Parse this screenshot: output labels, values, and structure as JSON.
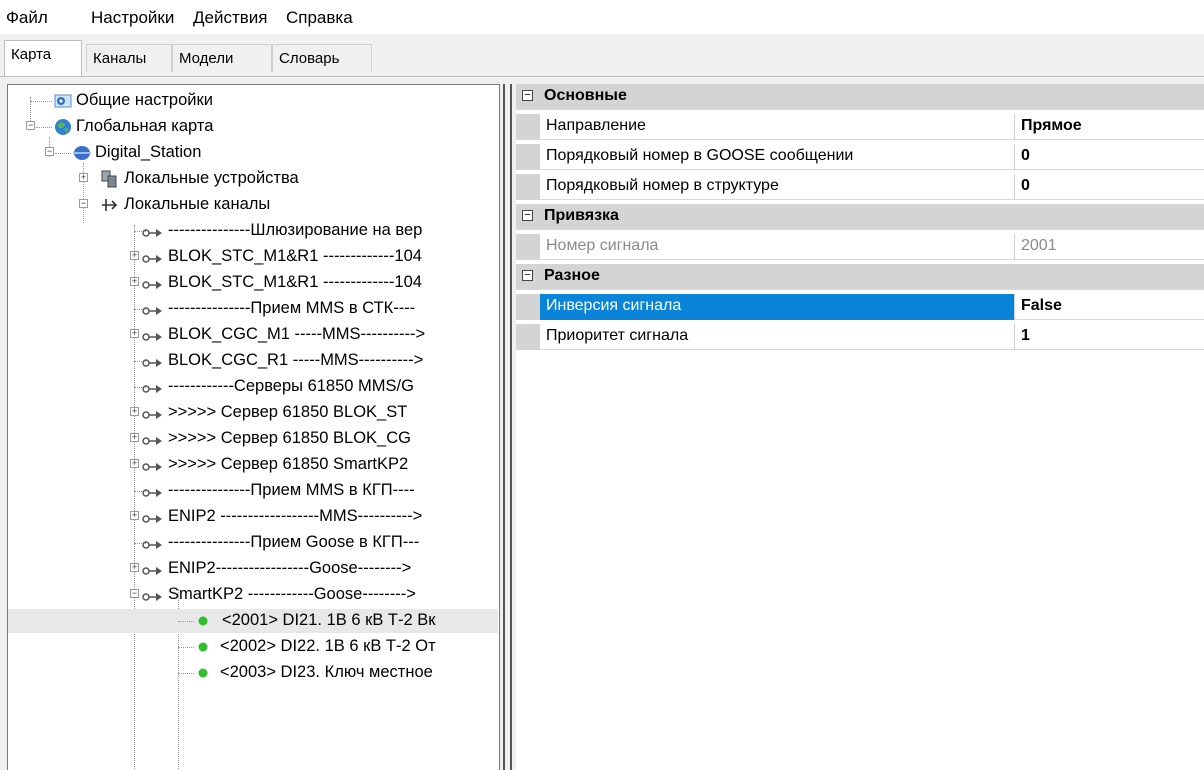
{
  "menu": [
    "Файл",
    "Настройки",
    "Действия",
    "Справка"
  ],
  "tabs": [
    "Карта",
    "Каналы",
    "Модели",
    "Словарь"
  ],
  "tree": [
    {
      "label": "Общие настройки",
      "icon": "settings-icon"
    },
    {
      "label": "Глобальная карта",
      "icon": "globe-icon"
    },
    {
      "label": "Digital_Station",
      "icon": "station-icon"
    },
    {
      "label": "Локальные устройства",
      "icon": "devices-icon"
    },
    {
      "label": "Локальные каналы",
      "icon": "channels-icon"
    },
    {
      "label": "---------------Шлюзирование на вер",
      "icon": "channel-icon"
    },
    {
      "label": "BLOK_STC_M1&R1 -------------104",
      "icon": "channel-icon"
    },
    {
      "label": "BLOK_STC_M1&R1 -------------104",
      "icon": "channel-icon"
    },
    {
      "label": "---------------Прием MMS в СТК----",
      "icon": "channel-icon"
    },
    {
      "label": "BLOK_CGC_M1 -----MMS---------->",
      "icon": "channel-icon"
    },
    {
      "label": "BLOK_CGC_R1 -----MMS---------->",
      "icon": "channel-icon"
    },
    {
      "label": "------------Серверы 61850 MMS/G",
      "icon": "channel-icon"
    },
    {
      "label": ">>>>>  Сервер 61850 BLOK_ST",
      "icon": "channel-icon"
    },
    {
      "label": ">>>>>  Сервер 61850 BLOK_CG",
      "icon": "channel-icon"
    },
    {
      "label": ">>>>>  Сервер 61850 SmartKP2",
      "icon": "channel-icon"
    },
    {
      "label": "---------------Прием MMS в КГП----",
      "icon": "channel-icon"
    },
    {
      "label": "ENIP2 ------------------MMS---------->",
      "icon": "channel-icon"
    },
    {
      "label": "---------------Прием Goose в КГП---",
      "icon": "channel-icon"
    },
    {
      "label": "ENIP2-----------------Goose-------->",
      "icon": "channel-icon"
    },
    {
      "label": "SmartKP2 ------------Goose-------->",
      "icon": "channel-icon"
    },
    {
      "label": "<2001> DI21. 1В 6 кВ Т-2 Вк",
      "icon": "signal-dot-icon"
    },
    {
      "label": "<2002> DI22. 1В 6 кВ Т-2 От",
      "icon": "signal-dot-icon"
    },
    {
      "label": "<2003> DI23. Ключ местное",
      "icon": "signal-dot-icon"
    }
  ],
  "properties": {
    "cat_main": "Основные",
    "direction_label": "Направление",
    "direction_value": "Прямое",
    "goose_index_label": "Порядковый номер в GOOSE сообщении",
    "goose_index_value": "0",
    "struct_index_label": "Порядковый номер в структуре",
    "struct_index_value": "0",
    "cat_binding": "Привязка",
    "signal_number_label": "Номер сигнала",
    "signal_number_value": "2001",
    "cat_misc": "Разное",
    "inversion_label": "Инверсия сигнала",
    "inversion_value": "False",
    "priority_label": "Приоритет сигнала",
    "priority_value": "1"
  },
  "colors": {
    "selection": "#0a84d8",
    "category": "#d4d4d4",
    "signal_dot": "#2dbf2d"
  }
}
